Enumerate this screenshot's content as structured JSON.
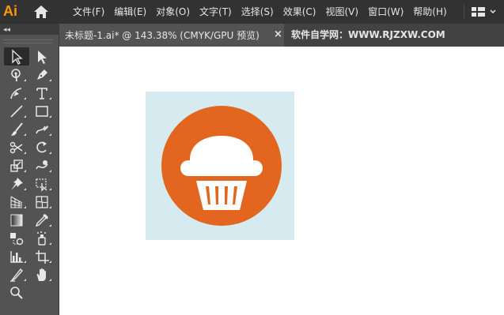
{
  "app": {
    "logo_text": "Ai"
  },
  "menu": {
    "items": [
      {
        "label": "文件(F)"
      },
      {
        "label": "编辑(E)"
      },
      {
        "label": "对象(O)"
      },
      {
        "label": "文字(T)"
      },
      {
        "label": "选择(S)"
      },
      {
        "label": "效果(C)"
      },
      {
        "label": "视图(V)"
      },
      {
        "label": "窗口(W)"
      },
      {
        "label": "帮助(H)"
      }
    ]
  },
  "document_tab": {
    "title": "未标题-1.ai* @ 143.38% (CMYK/GPU 预览)",
    "close_glyph": "×"
  },
  "watermark": "软件自学网：WWW.RJZXW.COM",
  "toolbar": {
    "collapse_glyph": "◂◂",
    "tools": [
      {
        "name": "selection-tool",
        "icon": "selection-arrow-icon",
        "active": true
      },
      {
        "name": "direct-selection-tool",
        "icon": "direct-selection-arrow-icon"
      },
      {
        "name": "magic-wand-tool",
        "icon": "magic-wand-icon"
      },
      {
        "name": "pen-tool",
        "icon": "pen-icon"
      },
      {
        "name": "curvature-tool",
        "icon": "curvature-pen-icon"
      },
      {
        "name": "type-tool",
        "icon": "type-icon"
      },
      {
        "name": "line-segment-tool",
        "icon": "line-segment-icon"
      },
      {
        "name": "rectangle-tool",
        "icon": "rectangle-icon"
      },
      {
        "name": "paintbrush-tool",
        "icon": "paintbrush-icon"
      },
      {
        "name": "shaper-tool",
        "icon": "shaper-icon"
      },
      {
        "name": "scissors-tool",
        "icon": "scissors-icon"
      },
      {
        "name": "rotate-tool",
        "icon": "rotate-icon"
      },
      {
        "name": "scale-tool",
        "icon": "scale-icon"
      },
      {
        "name": "warp-tool",
        "icon": "warp-icon"
      },
      {
        "name": "puppet-warp-tool",
        "icon": "pin-icon"
      },
      {
        "name": "free-transform-tool",
        "icon": "free-transform-icon"
      },
      {
        "name": "perspective-grid-tool",
        "icon": "perspective-grid-icon"
      },
      {
        "name": "mesh-tool",
        "icon": "mesh-icon"
      },
      {
        "name": "gradient-tool",
        "icon": "gradient-icon"
      },
      {
        "name": "eyedropper-tool",
        "icon": "eyedropper-icon"
      },
      {
        "name": "blend-tool",
        "icon": "blend-icon"
      },
      {
        "name": "symbol-sprayer-tool",
        "icon": "symbol-sprayer-icon"
      },
      {
        "name": "column-graph-tool",
        "icon": "column-graph-icon"
      },
      {
        "name": "artboard-tool",
        "icon": "artboard-icon"
      },
      {
        "name": "slice-tool",
        "icon": "slice-icon"
      },
      {
        "name": "hand-tool",
        "icon": "hand-icon"
      },
      {
        "name": "zoom-tool",
        "icon": "zoom-icon"
      }
    ]
  },
  "artwork": {
    "name": "cupcake-icon",
    "background_color": "#d6ebef",
    "circle_color": "#e2661f",
    "cupcake_color": "#ffffff"
  }
}
